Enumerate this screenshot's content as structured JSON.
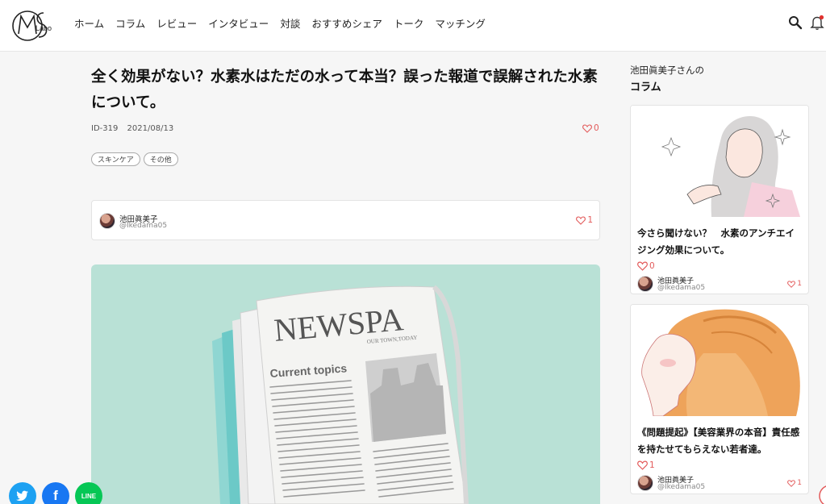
{
  "header": {
    "logo_text": "Labo",
    "nav": [
      "ホーム",
      "コラム",
      "レビュー",
      "インタビュー",
      "対談",
      "おすすめシェア",
      "トーク",
      "マッチング"
    ]
  },
  "article": {
    "title": "全く効果がない？水素水はただの水って本当？誤った報道で誤解された水素について。",
    "id": "ID-319",
    "date": "2021/08/13",
    "likes": "0",
    "tags": [
      "スキンケア",
      "その他"
    ],
    "author": {
      "name": "池田眞美子",
      "handle": "@Ikedama05",
      "likes": "1"
    },
    "image_text": {
      "masthead": "NEWSPA",
      "sub": "OUR TOWN,TODAY",
      "headline": "Current topics"
    }
  },
  "sidebar": {
    "heading_line1": "池田眞美子さんの",
    "heading_line2": "コラム",
    "cards": [
      {
        "title": "今さら聞けない？　水素のアンチエイジング効果について。",
        "likes": "0",
        "author_name": "池田眞美子",
        "author_handle": "@Ikedama05",
        "author_likes": "1"
      },
      {
        "title": "《問題提起》【美容業界の本音】責任感を持たせてもらえない若者達。",
        "likes": "1",
        "author_name": "池田眞美子",
        "author_handle": "@Ikedama05",
        "author_likes": "1"
      }
    ]
  },
  "social": {
    "facebook": "f",
    "line": "LINE"
  },
  "colors": {
    "accent_red": "#e35b5b",
    "hero_bg": "#b9e1d6",
    "twitter": "#1da1f2",
    "facebook": "#1877f2",
    "line": "#06c755"
  }
}
